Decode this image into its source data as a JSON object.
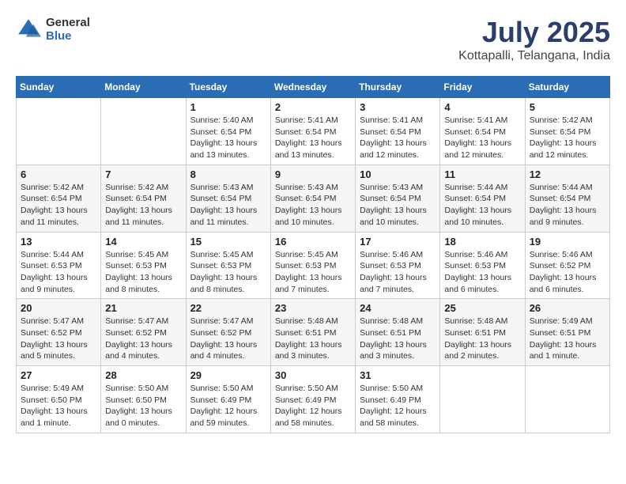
{
  "logo": {
    "general": "General",
    "blue": "Blue"
  },
  "title": "July 2025",
  "subtitle": "Kottapalli, Telangana, India",
  "headers": [
    "Sunday",
    "Monday",
    "Tuesday",
    "Wednesday",
    "Thursday",
    "Friday",
    "Saturday"
  ],
  "weeks": [
    [
      {
        "day": "",
        "detail": ""
      },
      {
        "day": "",
        "detail": ""
      },
      {
        "day": "1",
        "detail": "Sunrise: 5:40 AM\nSunset: 6:54 PM\nDaylight: 13 hours and 13 minutes."
      },
      {
        "day": "2",
        "detail": "Sunrise: 5:41 AM\nSunset: 6:54 PM\nDaylight: 13 hours and 13 minutes."
      },
      {
        "day": "3",
        "detail": "Sunrise: 5:41 AM\nSunset: 6:54 PM\nDaylight: 13 hours and 12 minutes."
      },
      {
        "day": "4",
        "detail": "Sunrise: 5:41 AM\nSunset: 6:54 PM\nDaylight: 13 hours and 12 minutes."
      },
      {
        "day": "5",
        "detail": "Sunrise: 5:42 AM\nSunset: 6:54 PM\nDaylight: 13 hours and 12 minutes."
      }
    ],
    [
      {
        "day": "6",
        "detail": "Sunrise: 5:42 AM\nSunset: 6:54 PM\nDaylight: 13 hours and 11 minutes."
      },
      {
        "day": "7",
        "detail": "Sunrise: 5:42 AM\nSunset: 6:54 PM\nDaylight: 13 hours and 11 minutes."
      },
      {
        "day": "8",
        "detail": "Sunrise: 5:43 AM\nSunset: 6:54 PM\nDaylight: 13 hours and 11 minutes."
      },
      {
        "day": "9",
        "detail": "Sunrise: 5:43 AM\nSunset: 6:54 PM\nDaylight: 13 hours and 10 minutes."
      },
      {
        "day": "10",
        "detail": "Sunrise: 5:43 AM\nSunset: 6:54 PM\nDaylight: 13 hours and 10 minutes."
      },
      {
        "day": "11",
        "detail": "Sunrise: 5:44 AM\nSunset: 6:54 PM\nDaylight: 13 hours and 10 minutes."
      },
      {
        "day": "12",
        "detail": "Sunrise: 5:44 AM\nSunset: 6:54 PM\nDaylight: 13 hours and 9 minutes."
      }
    ],
    [
      {
        "day": "13",
        "detail": "Sunrise: 5:44 AM\nSunset: 6:53 PM\nDaylight: 13 hours and 9 minutes."
      },
      {
        "day": "14",
        "detail": "Sunrise: 5:45 AM\nSunset: 6:53 PM\nDaylight: 13 hours and 8 minutes."
      },
      {
        "day": "15",
        "detail": "Sunrise: 5:45 AM\nSunset: 6:53 PM\nDaylight: 13 hours and 8 minutes."
      },
      {
        "day": "16",
        "detail": "Sunrise: 5:45 AM\nSunset: 6:53 PM\nDaylight: 13 hours and 7 minutes."
      },
      {
        "day": "17",
        "detail": "Sunrise: 5:46 AM\nSunset: 6:53 PM\nDaylight: 13 hours and 7 minutes."
      },
      {
        "day": "18",
        "detail": "Sunrise: 5:46 AM\nSunset: 6:53 PM\nDaylight: 13 hours and 6 minutes."
      },
      {
        "day": "19",
        "detail": "Sunrise: 5:46 AM\nSunset: 6:52 PM\nDaylight: 13 hours and 6 minutes."
      }
    ],
    [
      {
        "day": "20",
        "detail": "Sunrise: 5:47 AM\nSunset: 6:52 PM\nDaylight: 13 hours and 5 minutes."
      },
      {
        "day": "21",
        "detail": "Sunrise: 5:47 AM\nSunset: 6:52 PM\nDaylight: 13 hours and 4 minutes."
      },
      {
        "day": "22",
        "detail": "Sunrise: 5:47 AM\nSunset: 6:52 PM\nDaylight: 13 hours and 4 minutes."
      },
      {
        "day": "23",
        "detail": "Sunrise: 5:48 AM\nSunset: 6:51 PM\nDaylight: 13 hours and 3 minutes."
      },
      {
        "day": "24",
        "detail": "Sunrise: 5:48 AM\nSunset: 6:51 PM\nDaylight: 13 hours and 3 minutes."
      },
      {
        "day": "25",
        "detail": "Sunrise: 5:48 AM\nSunset: 6:51 PM\nDaylight: 13 hours and 2 minutes."
      },
      {
        "day": "26",
        "detail": "Sunrise: 5:49 AM\nSunset: 6:51 PM\nDaylight: 13 hours and 1 minute."
      }
    ],
    [
      {
        "day": "27",
        "detail": "Sunrise: 5:49 AM\nSunset: 6:50 PM\nDaylight: 13 hours and 1 minute."
      },
      {
        "day": "28",
        "detail": "Sunrise: 5:50 AM\nSunset: 6:50 PM\nDaylight: 13 hours and 0 minutes."
      },
      {
        "day": "29",
        "detail": "Sunrise: 5:50 AM\nSunset: 6:49 PM\nDaylight: 12 hours and 59 minutes."
      },
      {
        "day": "30",
        "detail": "Sunrise: 5:50 AM\nSunset: 6:49 PM\nDaylight: 12 hours and 58 minutes."
      },
      {
        "day": "31",
        "detail": "Sunrise: 5:50 AM\nSunset: 6:49 PM\nDaylight: 12 hours and 58 minutes."
      },
      {
        "day": "",
        "detail": ""
      },
      {
        "day": "",
        "detail": ""
      }
    ]
  ]
}
